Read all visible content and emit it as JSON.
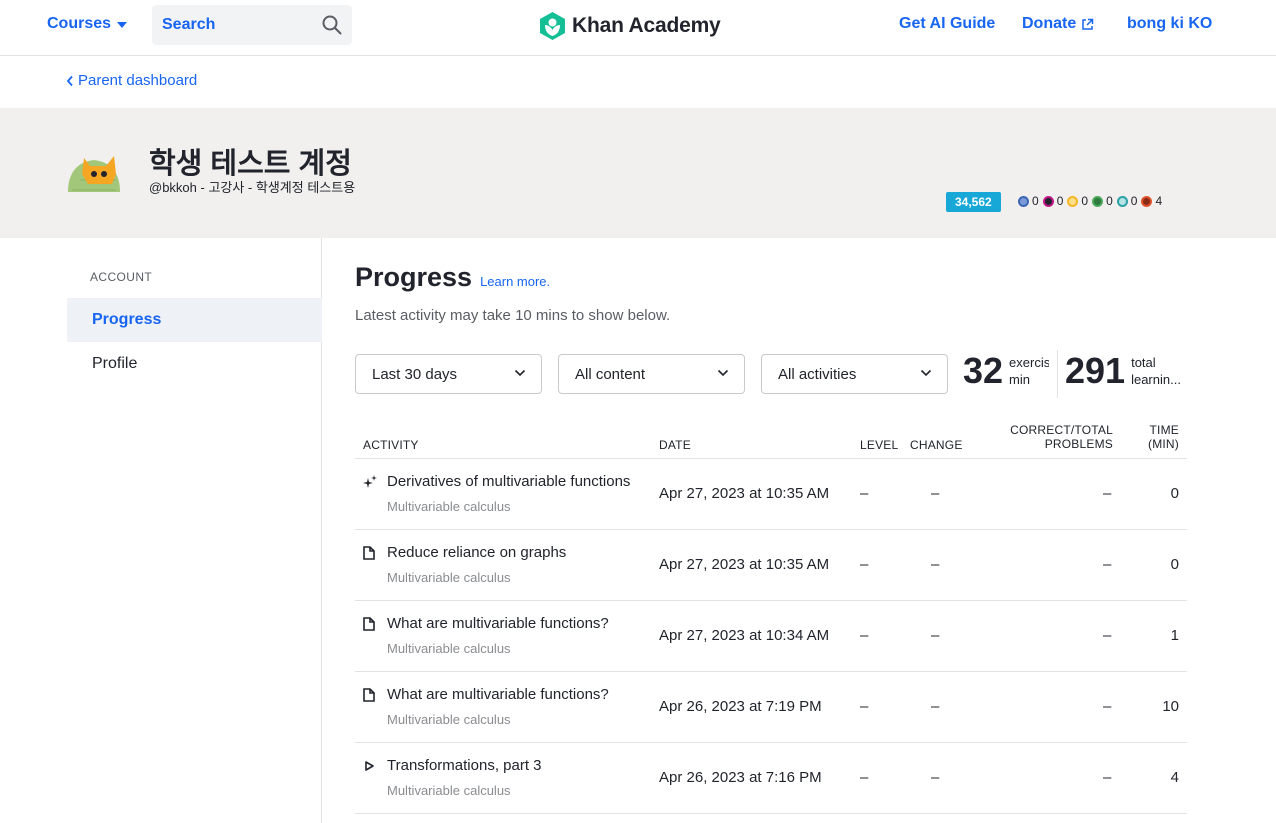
{
  "nav": {
    "courses_label": "Courses",
    "search_placeholder": "Search",
    "logo_text": "Khan Academy",
    "ai_guide_label": "Get AI Guide",
    "donate_label": "Donate",
    "user_label": "bong ki KO"
  },
  "breadcrumb": {
    "back_label": "Parent dashboard"
  },
  "profile": {
    "name": "학생 테스트 계정",
    "subtitle": "@bkkoh - 고강사 - 학생계정 테스트용",
    "points": "34,562",
    "badges": [
      {
        "icon": "meteorite-badge-icon",
        "count": "0",
        "color": "#3c66b5"
      },
      {
        "icon": "moon-badge-icon",
        "count": "0",
        "color": "#c2178a"
      },
      {
        "icon": "earth-badge-icon",
        "count": "0",
        "color": "#f5b625"
      },
      {
        "icon": "sun-badge-icon",
        "count": "0",
        "color": "#4aa85a"
      },
      {
        "icon": "black-hole-badge-icon",
        "count": "0",
        "color": "#2aa1a6"
      },
      {
        "icon": "challenge-patch-icon",
        "count": "4",
        "color": "#e0502a"
      }
    ]
  },
  "sidebar": {
    "section_label": "ACCOUNT",
    "items": [
      {
        "label": "Progress",
        "active": true
      },
      {
        "label": "Profile",
        "active": false
      }
    ]
  },
  "main": {
    "title": "Progress",
    "learn_more": "Learn more.",
    "subtitle": "Latest activity may take 10 mins to show below.",
    "filters": {
      "time": "Last 30 days",
      "content": "All content",
      "activities": "All activities"
    },
    "stats": [
      {
        "value": "32",
        "label_line1": "exercis",
        "label_line2": "min"
      },
      {
        "value": "291",
        "label_line1": "total",
        "label_line2": "learnin..."
      }
    ]
  },
  "table": {
    "headers": {
      "activity": "ACTIVITY",
      "date": "DATE",
      "level": "LEVEL",
      "change": "CHANGE",
      "correct_1": "CORRECT/TOTAL",
      "correct_2": "PROBLEMS",
      "time_1": "TIME",
      "time_2": "(MIN)"
    },
    "rows": [
      {
        "icon": "sparkle-icon",
        "title": "Derivatives of multivariable functions",
        "course": "Multivariable calculus",
        "date": "Apr 27, 2023 at 10:35 AM",
        "level": "–",
        "change": "–",
        "correct": "–",
        "time": "0"
      },
      {
        "icon": "article-icon",
        "title": "Reduce reliance on graphs",
        "course": "Multivariable calculus",
        "date": "Apr 27, 2023 at 10:35 AM",
        "level": "–",
        "change": "–",
        "correct": "–",
        "time": "0"
      },
      {
        "icon": "article-icon",
        "title": "What are multivariable functions?",
        "course": "Multivariable calculus",
        "date": "Apr 27, 2023 at 10:34 AM",
        "level": "–",
        "change": "–",
        "correct": "–",
        "time": "1"
      },
      {
        "icon": "article-icon",
        "title": "What are multivariable functions?",
        "course": "Multivariable calculus",
        "date": "Apr 26, 2023 at 7:19 PM",
        "level": "–",
        "change": "–",
        "correct": "–",
        "time": "10"
      },
      {
        "icon": "video-play-icon",
        "title": "Transformations, part 3",
        "course": "Multivariable calculus",
        "date": "Apr 26, 2023 at 7:16 PM",
        "level": "–",
        "change": "–",
        "correct": "–",
        "time": "4"
      }
    ]
  },
  "colors": {
    "accent": "#1865f2",
    "header_band": "#f1f0ee",
    "points_badge": "#18a8d8",
    "logo_green": "#14bf96"
  }
}
